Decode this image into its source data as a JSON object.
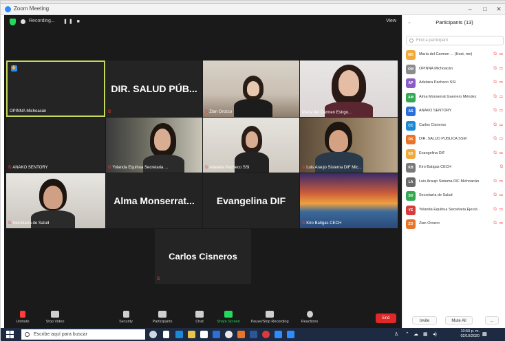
{
  "window": {
    "title": "Zoom Meeting",
    "controls": [
      "–",
      "□",
      "✕"
    ]
  },
  "meeting_top": {
    "recording_label": "Recording...",
    "recording_controls": "❚❚ ■",
    "view_label": "View"
  },
  "tiles": [
    {
      "id": "t1",
      "name": "OPINNA Michoacán",
      "big": "",
      "active": true
    },
    {
      "id": "t2",
      "name": "",
      "big": "DIR. SALUD PÚB...",
      "active": false
    },
    {
      "id": "t3",
      "name": "Ztan Orozco",
      "big": "",
      "active": false
    },
    {
      "id": "t4",
      "name": "María del Carmen Estrgo...",
      "big": "",
      "active": false
    },
    {
      "id": "t5",
      "name": "ANAKO SENTORY",
      "big": "",
      "active": false
    },
    {
      "id": "t6",
      "name": "Yolanda Equihua Secretaria ...",
      "big": "",
      "active": false
    },
    {
      "id": "t7",
      "name": "Adelaira Pacheco SSI",
      "big": "",
      "active": false
    },
    {
      "id": "t8",
      "name": "Luis Araujo Sistema DIF Mic...",
      "big": "",
      "active": false
    },
    {
      "id": "t9",
      "name": "Secretaría de Salud",
      "big": "",
      "active": false
    },
    {
      "id": "t10",
      "name": "",
      "big": "Alma Monserrat...",
      "active": false
    },
    {
      "id": "t11",
      "name": "",
      "big": "Evangelina DIF",
      "active": false
    },
    {
      "id": "t12",
      "name": "Kiro Batigas CECH",
      "big": "",
      "active": false
    },
    {
      "id": "t13",
      "name": "",
      "big": "Carlos Cisneros",
      "active": false
    }
  ],
  "toolbar": {
    "unmute": "Unmute",
    "stop_video": "Stop Video",
    "security": "Security",
    "participants": "Participants",
    "participants_count": "13",
    "chat": "Chat",
    "share_screen": "Share Screen",
    "pause_recording": "Pause/Stop Recording",
    "reactions": "Reactions",
    "end": "End"
  },
  "panel": {
    "title": "Participants (13)",
    "search_placeholder": "Find a participant",
    "invite": "Invite",
    "mute_all": "Mute All",
    "more": "...",
    "participants": [
      {
        "initials": "MD",
        "color": "#f0a93b",
        "name": "María del Carmen ... (Host, me)"
      },
      {
        "initials": "OM",
        "color": "#8c8c8c",
        "name": "OPINNA Michoacán"
      },
      {
        "initials": "AP",
        "color": "#8a5cc8",
        "name": "Adelaira Pacheco SSI"
      },
      {
        "initials": "AM",
        "color": "#34a853",
        "name": "Alma Monserrat Guerrero Méndez"
      },
      {
        "initials": "AS",
        "color": "#2d6fd8",
        "name": "ANAKO SENTORY"
      },
      {
        "initials": "CC",
        "color": "#1a8ad6",
        "name": "Carlos Cisneros"
      },
      {
        "initials": "DS",
        "color": "#e8742a",
        "name": "DIR. SALUD PÚBLICA SSM"
      },
      {
        "initials": "ED",
        "color": "#f0a93b",
        "name": "Evangelina DIF"
      },
      {
        "initials": "KB",
        "color": "#7a7a7a",
        "name": "Kiro Batigas CECH"
      },
      {
        "initials": "LA",
        "color": "#6b6b6b",
        "name": "Luis Araujo Sistema DIF Michoacán"
      },
      {
        "initials": "SD",
        "color": "#34a853",
        "name": "Secretaría de Salud"
      },
      {
        "initials": "YE",
        "color": "#d83b3b",
        "name": "Yolanda Equihua Secretaria Ejecut..."
      },
      {
        "initials": "ZO",
        "color": "#e8742a",
        "name": "Zian Orozco"
      }
    ]
  },
  "taskbar": {
    "search_placeholder": "Escribe aquí para buscar",
    "time": "10:50 p. m.",
    "date": "02/10/2020"
  },
  "colors": {
    "active_speaker": "#c6d85a",
    "muted": "#ff3b3b",
    "end_button": "#e02828",
    "taskbar": "#1d2a42"
  }
}
